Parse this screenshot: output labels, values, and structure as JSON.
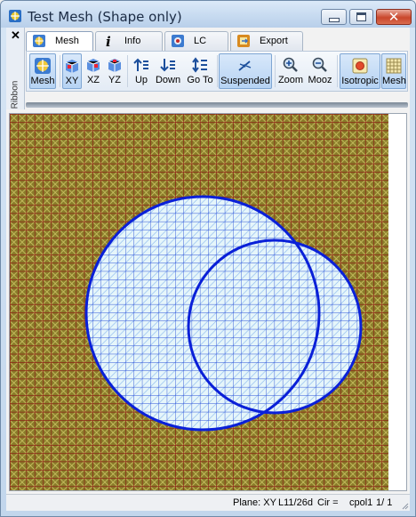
{
  "window": {
    "title": "Test Mesh (Shape only)"
  },
  "ribbon": {
    "label": "Ribbon",
    "close_glyph": "✕"
  },
  "tabs": [
    {
      "label": "Mesh",
      "icon": "mesh-globe-icon",
      "active": true
    },
    {
      "label": "Info",
      "icon": "info-icon",
      "active": false
    },
    {
      "label": "LC",
      "icon": "load-case-icon",
      "active": false
    },
    {
      "label": "Export",
      "icon": "export-icon",
      "active": false
    }
  ],
  "toolbar": {
    "buttons": [
      {
        "label": "Mesh",
        "icon": "mesh-globe-icon",
        "pressed": true
      },
      {
        "label": "XY",
        "icon": "cube-xy-icon",
        "pressed": true
      },
      {
        "label": "XZ",
        "icon": "cube-xz-icon",
        "pressed": false
      },
      {
        "label": "YZ",
        "icon": "cube-yz-icon",
        "pressed": false
      },
      {
        "label": "Up",
        "icon": "sort-up-icon",
        "pressed": false
      },
      {
        "label": "Down",
        "icon": "sort-down-icon",
        "pressed": false
      },
      {
        "label": "Go To",
        "icon": "goto-icon",
        "pressed": false
      },
      {
        "label": "Suspended",
        "icon": "suspended-icon",
        "pressed": true
      },
      {
        "label": "Zoom",
        "icon": "zoom-in-icon",
        "pressed": false
      },
      {
        "label": "Mooz",
        "icon": "zoom-out-icon",
        "pressed": false
      },
      {
        "label": "Isotropic",
        "icon": "isotropic-icon",
        "pressed": true
      },
      {
        "label": "Mesh",
        "icon": "grid-icon",
        "pressed": true
      }
    ]
  },
  "canvas": {
    "background_mesh_color": "#8a7b2a",
    "background_grid_color": "#8b1010",
    "diagonal_color": "#c8c060",
    "shape_fill": "#e6f6fa",
    "shape_grid_color": "#2a50d8",
    "outline_color": "#0a20d8"
  },
  "status": {
    "plane": "Plane: XY",
    "level": "L11/26d",
    "cir": "Cir =",
    "layer": "cpol1",
    "page": "1/ 1"
  }
}
